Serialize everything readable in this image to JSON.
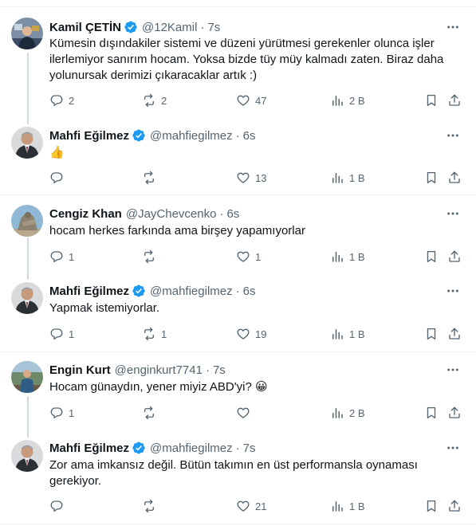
{
  "colors": {
    "verified": "#1d9bf0",
    "icon_gray": "#536471",
    "thread_line": "#cfd9de",
    "separator": "#eff3f4"
  },
  "tweets": [
    {
      "name": "Kamil ÇETİN",
      "verified": true,
      "handle": "@12Kamil",
      "dot": "·",
      "time": "7s",
      "text": "Kümesin dışındakiler sistemi ve düzeni yürütmesi gerekenler olunca işler ilerlemiyor sanırım hocam. Yoksa bizde tüy müy kalmadı zaten. Biraz daha yolunursak derimizi çıkaracaklar artık :)",
      "replies": "2",
      "retweets": "2",
      "likes": "47",
      "views": "2 B",
      "avatar_icon": "user-avatar-photo"
    },
    {
      "name": "Mahfi Eğilmez",
      "verified": true,
      "handle": "@mahfiegilmez",
      "dot": "·",
      "time": "6s",
      "text": "👍",
      "replies": "",
      "retweets": "",
      "likes": "13",
      "views": "1 B",
      "avatar_icon": "user-avatar-photo"
    },
    {
      "name": "Cengiz Khan",
      "verified": false,
      "handle": "@JayChevcenko",
      "dot": "·",
      "time": "6s",
      "text": "hocam herkes farkında ama birşey yapamıyorlar",
      "replies": "1",
      "retweets": "",
      "likes": "1",
      "views": "1 B",
      "avatar_icon": "user-avatar-photo"
    },
    {
      "name": "Mahfi Eğilmez",
      "verified": true,
      "handle": "@mahfiegilmez",
      "dot": "·",
      "time": "6s",
      "text": "Yapmak istemiyorlar.",
      "replies": "1",
      "retweets": "1",
      "likes": "19",
      "views": "1 B",
      "avatar_icon": "user-avatar-photo"
    },
    {
      "name": "Engin Kurt",
      "verified": false,
      "handle": "@enginkurt7741",
      "dot": "·",
      "time": "7s",
      "text": "Hocam günaydın, yener miyiz ABD'yi? 😀",
      "replies": "1",
      "retweets": "",
      "likes": "",
      "views": "2 B",
      "avatar_icon": "user-avatar-photo"
    },
    {
      "name": "Mahfi Eğilmez",
      "verified": true,
      "handle": "@mahfiegilmez",
      "dot": "·",
      "time": "7s",
      "text": "Zor ama imkansız değil. Bütün takımın en üst performansla oynaması gerekiyor.",
      "replies": "",
      "retweets": "",
      "likes": "21",
      "views": "1 B",
      "avatar_icon": "user-avatar-photo"
    }
  ]
}
